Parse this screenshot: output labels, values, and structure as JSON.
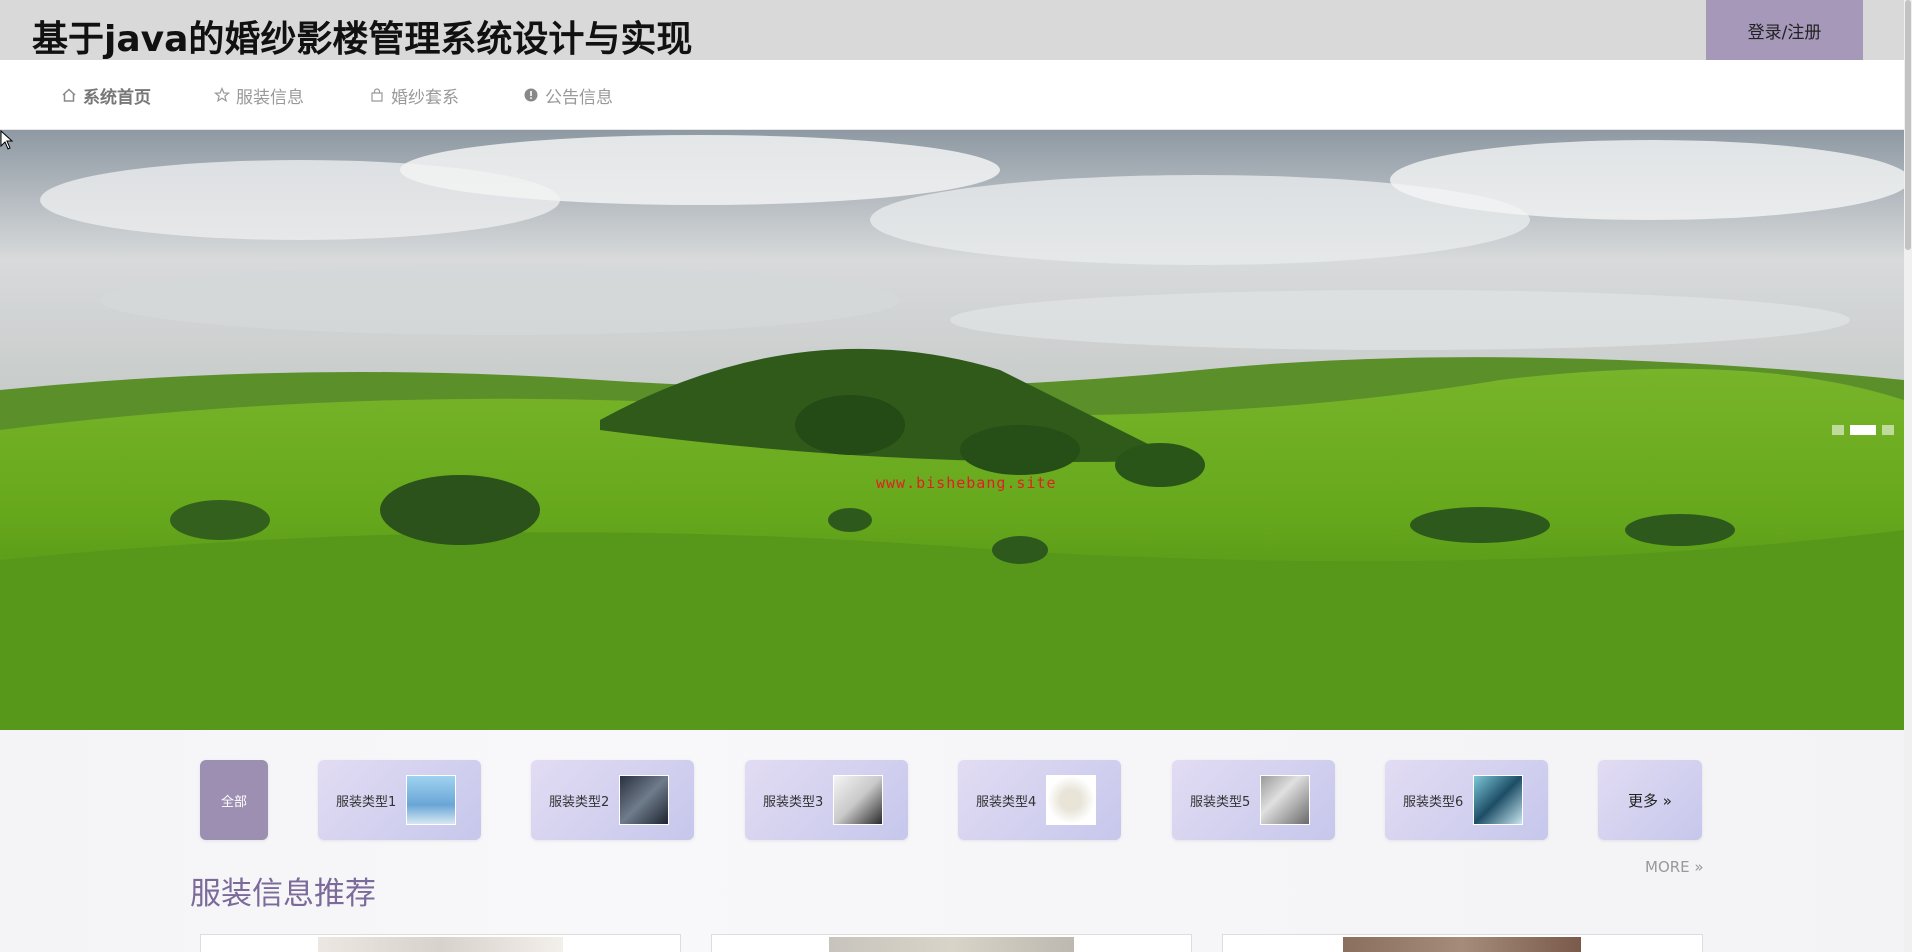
{
  "header": {
    "site_title": "基于java的婚纱影楼管理系统设计与实现",
    "login_label": "登录/注册"
  },
  "nav": [
    {
      "label": "系统首页",
      "icon": "home-icon"
    },
    {
      "label": "服装信息",
      "icon": "star-icon"
    },
    {
      "label": "婚纱套系",
      "icon": "bag-icon"
    },
    {
      "label": "公告信息",
      "icon": "info-icon"
    }
  ],
  "banner": {
    "watermark": "www.bishebang.site",
    "slide_count": 3,
    "active_slide": 2
  },
  "categories": {
    "all_label": "全部",
    "items": [
      "服装类型1",
      "服装类型2",
      "服装类型3",
      "服装类型4",
      "服装类型5",
      "服装类型6"
    ],
    "more_label": "更多 »"
  },
  "section": {
    "title": "服装信息推荐",
    "more_label": "MORE »"
  },
  "colors": {
    "accent": "#a598b9",
    "title_purple": "#7b6a9a"
  }
}
